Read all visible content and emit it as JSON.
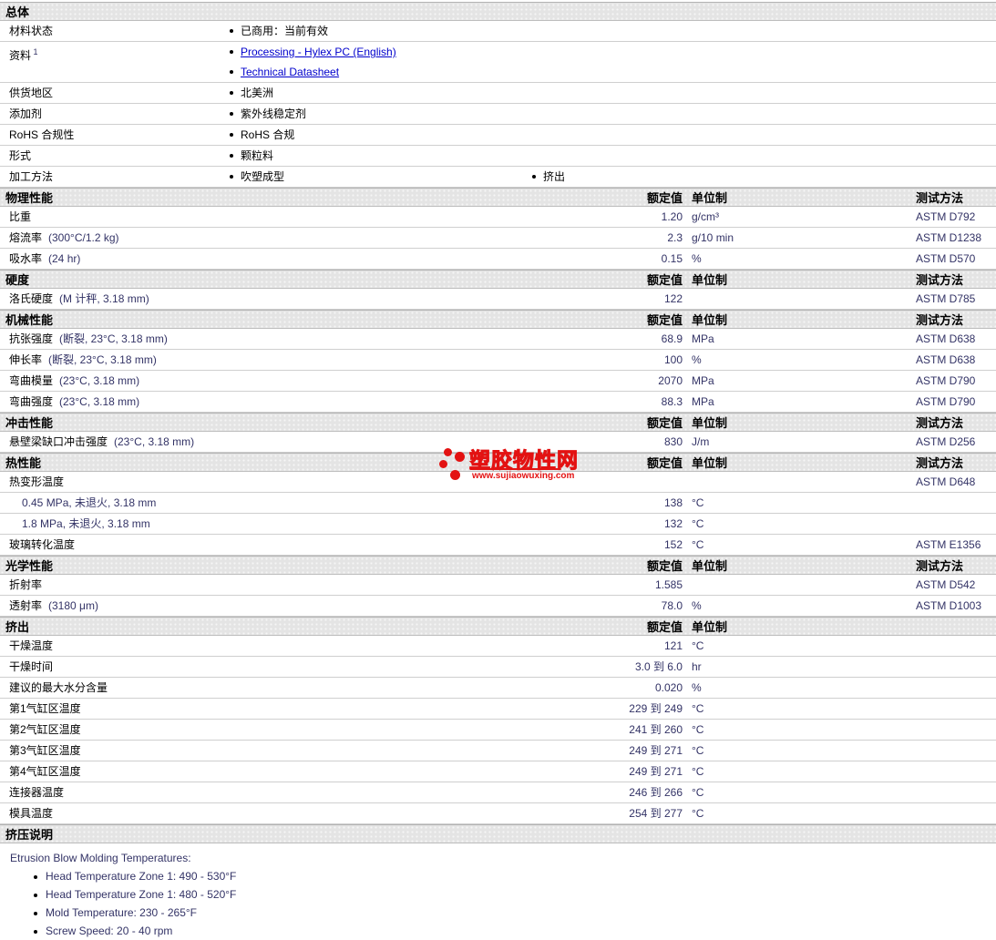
{
  "watermark": {
    "name": "塑胶物性网",
    "url": "www.sujiaowuxing.com",
    "accent_color": "#e31212"
  },
  "colors": {
    "link_blue": "#0000cc",
    "value_navy": "#333366",
    "band_gray": "#e4e4e4"
  },
  "col_headers": {
    "value": "额定值",
    "unit": "单位制",
    "method": "测试方法"
  },
  "general": {
    "title": "总体",
    "rows": [
      {
        "label": "材料状态",
        "sup": "",
        "items": [
          "已商用：当前有效"
        ],
        "links": false,
        "stacked": false
      },
      {
        "label": "资料",
        "sup": "1",
        "items": [
          "Processing - Hylex PC (English)",
          "Technical Datasheet"
        ],
        "links": true,
        "stacked": true
      },
      {
        "label": "供货地区",
        "sup": "",
        "items": [
          "北美洲"
        ],
        "links": false,
        "stacked": false
      },
      {
        "label": "添加剂",
        "sup": "",
        "items": [
          "紫外线稳定剂"
        ],
        "links": false,
        "stacked": false
      },
      {
        "label": "RoHS 合规性",
        "sup": "",
        "items": [
          "RoHS 合规"
        ],
        "links": false,
        "stacked": false
      },
      {
        "label": "形式",
        "sup": "",
        "items": [
          "颗粒料"
        ],
        "links": false,
        "stacked": false
      },
      {
        "label": "加工方法",
        "sup": "",
        "items": [
          "吹塑成型",
          "挤出"
        ],
        "links": false,
        "stacked": false
      }
    ]
  },
  "sections": [
    {
      "title": "物理性能",
      "show_method_header": true,
      "rows": [
        {
          "label": "比重",
          "cond": "",
          "indent": false,
          "value": "1.20",
          "unit": "g/cm³",
          "method": "ASTM D792"
        },
        {
          "label": "熔流率",
          "cond": "(300°C/1.2 kg)",
          "indent": false,
          "value": "2.3",
          "unit": "g/10 min",
          "method": "ASTM D1238"
        },
        {
          "label": "吸水率",
          "cond": "(24 hr)",
          "indent": false,
          "value": "0.15",
          "unit": "%",
          "method": "ASTM D570"
        }
      ]
    },
    {
      "title": "硬度",
      "show_method_header": true,
      "rows": [
        {
          "label": "洛氏硬度",
          "cond": "(M 计秤, 3.18 mm)",
          "indent": false,
          "value": "122",
          "unit": "",
          "method": "ASTM D785"
        }
      ]
    },
    {
      "title": "机械性能",
      "show_method_header": true,
      "rows": [
        {
          "label": "抗张强度",
          "cond": "(断裂, 23°C, 3.18 mm)",
          "indent": false,
          "value": "68.9",
          "unit": "MPa",
          "method": "ASTM D638"
        },
        {
          "label": "伸长率",
          "cond": "(断裂, 23°C, 3.18 mm)",
          "indent": false,
          "value": "100",
          "unit": "%",
          "method": "ASTM D638"
        },
        {
          "label": "弯曲模量",
          "cond": "(23°C, 3.18 mm)",
          "indent": false,
          "value": "2070",
          "unit": "MPa",
          "method": "ASTM D790"
        },
        {
          "label": "弯曲强度",
          "cond": "(23°C, 3.18 mm)",
          "indent": false,
          "value": "88.3",
          "unit": "MPa",
          "method": "ASTM D790"
        }
      ]
    },
    {
      "title": "冲击性能",
      "show_method_header": true,
      "rows": [
        {
          "label": "悬壁梁缺口冲击强度",
          "cond": "(23°C, 3.18 mm)",
          "indent": false,
          "value": "830",
          "unit": "J/m",
          "method": "ASTM D256"
        }
      ]
    },
    {
      "title": "热性能",
      "show_method_header": true,
      "rows": [
        {
          "label": "热变形温度",
          "cond": "",
          "indent": false,
          "value": "",
          "unit": "",
          "method": "ASTM D648"
        },
        {
          "label": "0.45 MPa, 未退火, 3.18 mm",
          "cond": "",
          "indent": true,
          "value": "138",
          "unit": "°C",
          "method": ""
        },
        {
          "label": "1.8 MPa, 未退火, 3.18 mm",
          "cond": "",
          "indent": true,
          "value": "132",
          "unit": "°C",
          "method": ""
        },
        {
          "label": "玻璃转化温度",
          "cond": "",
          "indent": false,
          "value": "152",
          "unit": "°C",
          "method": "ASTM E1356"
        }
      ]
    },
    {
      "title": "光学性能",
      "show_method_header": true,
      "rows": [
        {
          "label": "折射率",
          "cond": "",
          "indent": false,
          "value": "1.585",
          "unit": "",
          "method": "ASTM D542"
        },
        {
          "label": "透射率",
          "cond": "(3180 μm)",
          "indent": false,
          "value": "78.0",
          "unit": "%",
          "method": "ASTM D1003"
        }
      ]
    },
    {
      "title": "挤出",
      "show_method_header": false,
      "rows": [
        {
          "label": "干燥温度",
          "cond": "",
          "indent": false,
          "value": "121",
          "unit": "°C",
          "method": ""
        },
        {
          "label": "干燥时间",
          "cond": "",
          "indent": false,
          "value": "3.0 到 6.0",
          "unit": "hr",
          "method": ""
        },
        {
          "label": "建议的最大水分含量",
          "cond": "",
          "indent": false,
          "value": "0.020",
          "unit": "%",
          "method": ""
        },
        {
          "label": "第1气缸区温度",
          "cond": "",
          "indent": false,
          "value": "229 到 249",
          "unit": "°C",
          "method": ""
        },
        {
          "label": "第2气缸区温度",
          "cond": "",
          "indent": false,
          "value": "241 到 260",
          "unit": "°C",
          "method": ""
        },
        {
          "label": "第3气缸区温度",
          "cond": "",
          "indent": false,
          "value": "249 到 271",
          "unit": "°C",
          "method": ""
        },
        {
          "label": "第4气缸区温度",
          "cond": "",
          "indent": false,
          "value": "249 到 271",
          "unit": "°C",
          "method": ""
        },
        {
          "label": "连接器温度",
          "cond": "",
          "indent": false,
          "value": "246 到 266",
          "unit": "°C",
          "method": ""
        },
        {
          "label": "模具温度",
          "cond": "",
          "indent": false,
          "value": "254 到 277",
          "unit": "°C",
          "method": ""
        }
      ]
    }
  ],
  "notes": {
    "title": "挤压说明",
    "intro": "Etrusion Blow Molding Temperatures:",
    "bullets": [
      "Head Temperature Zone 1: 490 - 530°F",
      "Head Temperature Zone 1: 480 - 520°F",
      "Mold Temperature: 230 - 265°F",
      "Screw Speed: 20 - 40 rpm"
    ]
  }
}
